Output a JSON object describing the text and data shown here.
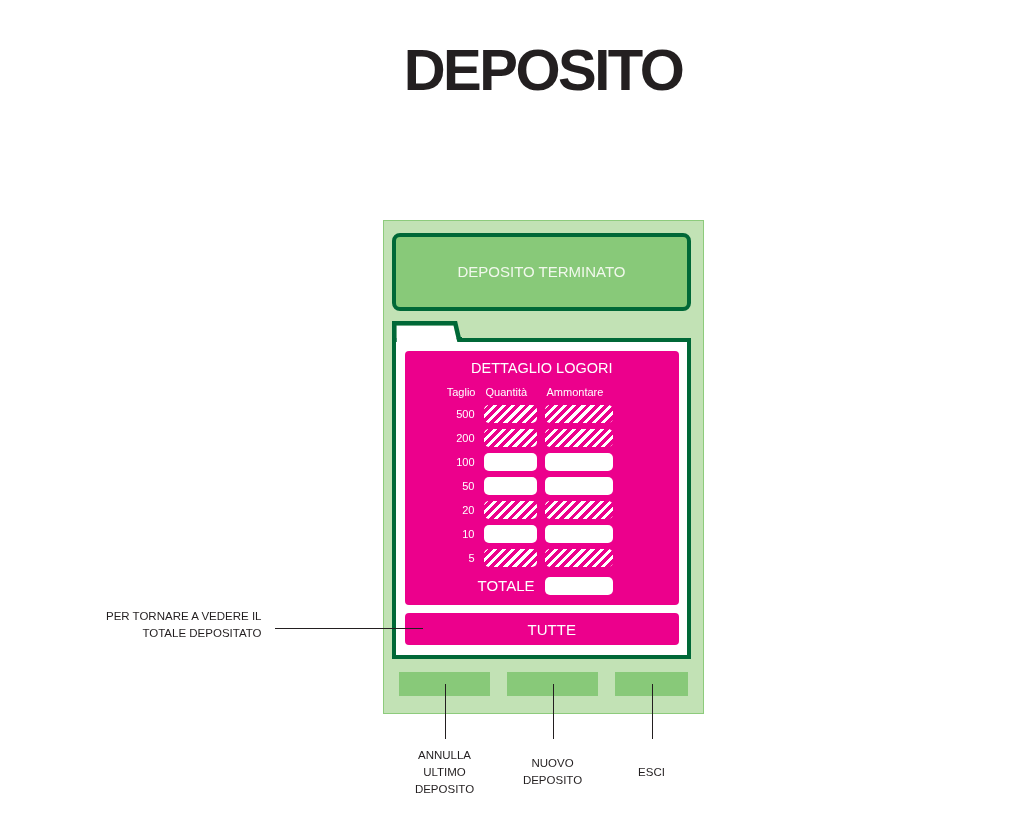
{
  "title": "DEPOSITO",
  "device": {
    "banner": "DEPOSITO TERMINATO",
    "detail": {
      "title": "DETTAGLIO LOGORI",
      "columns": [
        "Taglio",
        "Quantità",
        "Ammontare"
      ],
      "rows": [
        {
          "denomination": "500",
          "disabled": true
        },
        {
          "denomination": "200",
          "disabled": true
        },
        {
          "denomination": "100",
          "disabled": false
        },
        {
          "denomination": "50",
          "disabled": false
        },
        {
          "denomination": "20",
          "disabled": true
        },
        {
          "denomination": "10",
          "disabled": false
        },
        {
          "denomination": "5",
          "disabled": true
        }
      ],
      "total": {
        "label": "TOTALE"
      }
    },
    "all_button": {
      "label": "TUTTE",
      "annotation": "PER TORNARE A VEDERE IL TOTALE DEPOSITATO"
    },
    "footer_buttons": [
      {
        "annotation": "ANNULLA ULTIMO DEPOSITO"
      },
      {
        "annotation": "NUOVO DEPOSITO"
      },
      {
        "annotation": "ESCI"
      }
    ]
  }
}
